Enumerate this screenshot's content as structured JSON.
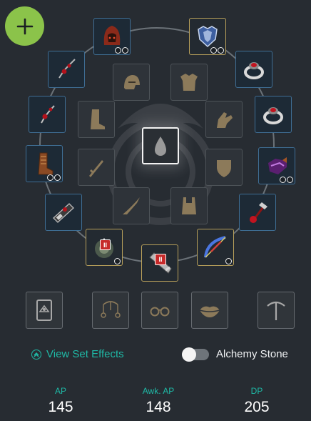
{
  "add_button": {
    "icon": "plus-icon",
    "color": "#8bc34a"
  },
  "gear_slots": [
    {
      "name": "helmet-slot",
      "icon": "hooded-helmet-icon",
      "socket_count": 2
    },
    {
      "name": "armor-slot",
      "icon": "blue-armor-icon",
      "socket_count": 2
    },
    {
      "name": "necklace-slot",
      "icon": "necklace-icon"
    },
    {
      "name": "ring-1-slot",
      "icon": "ring-icon"
    },
    {
      "name": "earring-1-slot",
      "icon": "earring-icon"
    },
    {
      "name": "ring-2-slot",
      "icon": "ring-icon"
    },
    {
      "name": "earring-2-slot",
      "icon": "earring-icon"
    },
    {
      "name": "gloves-slot",
      "icon": "purple-gloves-icon",
      "socket_count": 2
    },
    {
      "name": "boots-slot",
      "icon": "boots-icon",
      "socket_count": 2
    },
    {
      "name": "belt-slot",
      "icon": "belt-icon"
    },
    {
      "name": "artifact-slot",
      "icon": "artifact-icon"
    },
    {
      "name": "main-weapon-slot",
      "icon": "crossbow-icon",
      "badge": "II",
      "socket_count": 1
    },
    {
      "name": "sub-weapon-slot",
      "icon": "ornament-knot-icon",
      "badge": "II",
      "socket_count": 1
    },
    {
      "name": "awakening-weapon-slot",
      "icon": "cannon-icon",
      "badge": "II"
    }
  ],
  "outfit_slots": [
    {
      "name": "outfit-helmet-slot",
      "icon": "helmet-outline-icon"
    },
    {
      "name": "outfit-armor-slot",
      "icon": "armor-outline-icon"
    },
    {
      "name": "outfit-boots-slot",
      "icon": "boots-outline-icon"
    },
    {
      "name": "outfit-gloves-slot",
      "icon": "gloves-outline-icon"
    },
    {
      "name": "outfit-center-slot",
      "icon": "droplet-icon"
    },
    {
      "name": "outfit-sub-weapon-slot",
      "icon": "dagger-outline-icon"
    },
    {
      "name": "outfit-shield-slot",
      "icon": "shield-outline-icon"
    },
    {
      "name": "outfit-weapon-slot",
      "icon": "knife-outline-icon"
    },
    {
      "name": "outfit-underwear-slot",
      "icon": "vest-outline-icon"
    }
  ],
  "accessory_row": [
    {
      "name": "alchemy-stone-slot",
      "icon": "stone-card-icon"
    },
    {
      "name": "earrings-cosmetic-slot",
      "icon": "earrings-cosmetic-icon"
    },
    {
      "name": "glasses-slot",
      "icon": "glasses-icon"
    },
    {
      "name": "lips-slot",
      "icon": "lips-icon"
    },
    {
      "name": "pickaxe-slot",
      "icon": "pickaxe-icon"
    }
  ],
  "links": {
    "view_set_effects": "View Set Effects"
  },
  "toggle": {
    "label": "Alchemy Stone",
    "on": false
  },
  "stats": [
    {
      "label": "AP",
      "value": "145"
    },
    {
      "label": "Awk. AP",
      "value": "148"
    },
    {
      "label": "DP",
      "value": "205"
    }
  ],
  "colors": {
    "background": "#272c32",
    "accent_teal": "#1fb9a6",
    "slot_blue_border": "#3f6e94",
    "slot_gold_border": "#b8a05a"
  }
}
